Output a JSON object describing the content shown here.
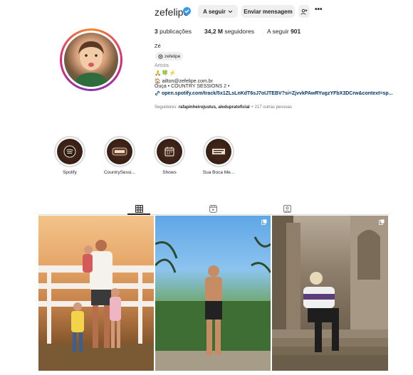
{
  "profile": {
    "username": "zefelipe",
    "follow_label": "A seguir",
    "message_label": "Enviar mensagem",
    "more_label": "•••"
  },
  "stats": {
    "posts_count": "3",
    "posts_label": "publicações",
    "followers_count": "34,2 M",
    "followers_label": "seguidores",
    "following_label": "A seguir",
    "following_count": "901"
  },
  "bio": {
    "name": "Zé",
    "threads_handle": "zefelipe",
    "category": "Artista",
    "emojis": "🙏🍀⚡",
    "email": "🏠 ailton@zefelipe.com.br",
    "line": "Ouça • COUNTRY SESSIONS 2 •",
    "link": "open.spotify.com/track/5x1ZLsLnKdT6sJ7oIJTEBV?si=ZjvvkPAwRYugzYFbX3DCrw&context=sp...",
    "followed_by_prefix": "Seguidores:",
    "followed_by_names": "rafapinheirojustus, aledupratoficial",
    "followed_by_suffix": "+ 217 outras pessoas"
  },
  "highlights": [
    {
      "label": "Spotify",
      "icon": "spotify-icon"
    },
    {
      "label": "CountrySessi...",
      "icon": "country-sessions-icon"
    },
    {
      "label": "Shows",
      "icon": "calendar-icon"
    },
    {
      "label": "Sua Boca Me...",
      "icon": "sua-boca-icon"
    }
  ],
  "tabs": [
    {
      "name": "posts",
      "icon": "grid-icon",
      "active": true
    },
    {
      "name": "reels",
      "icon": "reels-icon",
      "active": false
    },
    {
      "name": "tagged",
      "icon": "tagged-icon",
      "active": false
    }
  ],
  "posts": [
    {
      "icon": "carousel-icon"
    },
    {
      "icon": "carousel-icon"
    },
    {
      "icon": "carousel-icon"
    }
  ],
  "colors": {
    "verified": "#3897f0",
    "link": "#00376b",
    "button_bg": "#efefef"
  }
}
